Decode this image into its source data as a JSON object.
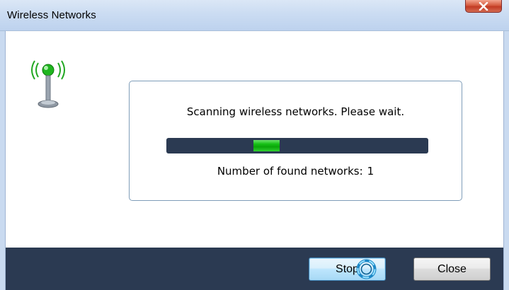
{
  "window": {
    "title": "Wireless Networks",
    "close_glyph": "X"
  },
  "icons": {
    "title_close": "close-icon",
    "antenna": "wireless-antenna-icon",
    "cursor": "busy-cursor-icon"
  },
  "scan": {
    "status_text": "Scanning wireless networks. Please wait.",
    "progress_state": "indeterminate",
    "found_label": "Number of found networks:",
    "found_count": "1"
  },
  "buttons": {
    "stop_label": "Stop",
    "close_label": "Close"
  },
  "colors": {
    "button_bar": "#2b3a52",
    "progress_track": "#2b3a52",
    "progress_chunk": "#16c016",
    "panel_border": "#7f9db9",
    "title_close_red": "#c23b24"
  }
}
